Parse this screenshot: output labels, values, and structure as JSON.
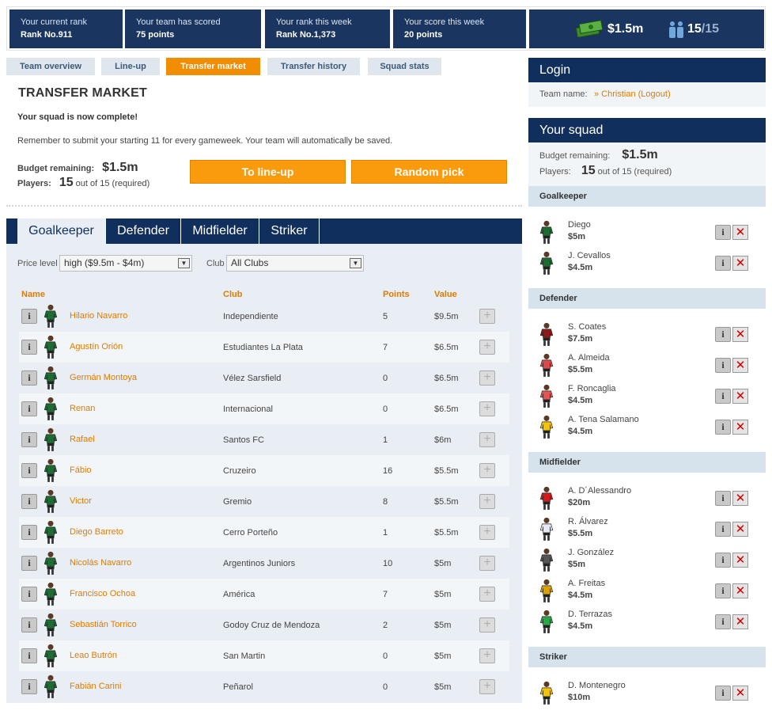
{
  "header": {
    "stats": [
      {
        "title": "Your current rank",
        "value": "Rank No.911"
      },
      {
        "title": "Your team has scored",
        "value": "75 points"
      },
      {
        "title": "Your rank this week",
        "value": "Rank No.1,373"
      },
      {
        "title": "Your score this week",
        "value": "20 points"
      }
    ],
    "budget": "$1.5m",
    "players_count": "15",
    "players_total": "/15"
  },
  "tabs": [
    "Team overview",
    "Line-up",
    "Transfer market",
    "Transfer history",
    "Squad stats"
  ],
  "transfer": {
    "title": "TRANSFER MARKET",
    "msg_complete": "Your squad is now complete!",
    "msg_reminder": "Remember to submit your starting 11 for every gameweek. Your team will automatically be saved.",
    "budget_label": "Budget remaining:",
    "budget_value": "$1.5m",
    "players_label": "Players:",
    "players_value": "15",
    "players_note": "out of 15 (required)",
    "btn_lineup": "To line-up",
    "btn_random": "Random pick"
  },
  "positions": [
    "Goalkeeper",
    "Defender",
    "Midfielder",
    "Striker"
  ],
  "filters": {
    "price_label": "Price level",
    "price_value": "high ($9.5m - $4m)",
    "club_label": "Club",
    "club_value": "All Clubs"
  },
  "columns": {
    "name": "Name",
    "club": "Club",
    "points": "Points",
    "value": "Value"
  },
  "players": [
    {
      "name": "Hilario Navarro",
      "club": "Independiente",
      "points": "5",
      "value": "$9.5m"
    },
    {
      "name": "Agustín Orión",
      "club": "Estudiantes La Plata",
      "points": "7",
      "value": "$6.5m"
    },
    {
      "name": "Germán Montoya",
      "club": "Vélez Sarsfield",
      "points": "0",
      "value": "$6.5m"
    },
    {
      "name": "Renan",
      "club": "Internacional",
      "points": "0",
      "value": "$6.5m"
    },
    {
      "name": "Rafael",
      "club": "Santos FC",
      "points": "1",
      "value": "$6m"
    },
    {
      "name": "Fábio",
      "club": "Cruzeiro",
      "points": "16",
      "value": "$5.5m"
    },
    {
      "name": "Victor",
      "club": "Gremio",
      "points": "8",
      "value": "$5.5m"
    },
    {
      "name": "Diego Barreto",
      "club": "Cerro Porteño",
      "points": "1",
      "value": "$5.5m"
    },
    {
      "name": "Nicolás Navarro",
      "club": "Argentinos Juniors",
      "points": "10",
      "value": "$5m"
    },
    {
      "name": "Francisco Ochoa",
      "club": "América",
      "points": "7",
      "value": "$5m"
    },
    {
      "name": "Sebastián Torrico",
      "club": "Godoy Cruz de Mendoza",
      "points": "2",
      "value": "$5m"
    },
    {
      "name": "Leao Butrón",
      "club": "San Martin",
      "points": "0",
      "value": "$5m"
    },
    {
      "name": "Fabián Carini",
      "club": "Peñarol",
      "points": "0",
      "value": "$5m"
    }
  ],
  "login": {
    "header": "Login",
    "team_label": "Team name:",
    "team_value": "» Christian (Logout)"
  },
  "squad": {
    "header": "Your squad",
    "budget_label": "Budget remaining:",
    "budget_value": "$1.5m",
    "players_label": "Players:",
    "players_value": "15",
    "players_note": "out of 15 (required)",
    "sections": [
      {
        "title": "Goalkeeper",
        "players": [
          {
            "name": "Diego",
            "price": "$5m",
            "kit": "#1f6b34"
          },
          {
            "name": "J. Cevallos",
            "price": "$4.5m",
            "kit": "#1f6b34"
          }
        ]
      },
      {
        "title": "Defender",
        "players": [
          {
            "name": "S. Coates",
            "price": "$7.5m",
            "kit": "#8b1a1a"
          },
          {
            "name": "A. Almeida",
            "price": "$5.5m",
            "kit": "#d94b4b"
          },
          {
            "name": "F. Roncaglia",
            "price": "$4.5m",
            "kit": "#e05555"
          },
          {
            "name": "A. Tena Salamano",
            "price": "$4.5m",
            "kit": "#f2c500"
          }
        ]
      },
      {
        "title": "Midfielder",
        "players": [
          {
            "name": "A. D´Alessandro",
            "price": "$20m",
            "kit": "#d01c1c"
          },
          {
            "name": "R. Álvarez",
            "price": "$5.5m",
            "kit": "#e8e8f4"
          },
          {
            "name": "J. González",
            "price": "$5m",
            "kit": "#555555"
          },
          {
            "name": "A. Freitas",
            "price": "$4.5m",
            "kit": "#d9a300"
          },
          {
            "name": "D. Terrazas",
            "price": "$4.5m",
            "kit": "#2aa847"
          }
        ]
      },
      {
        "title": "Striker",
        "players": [
          {
            "name": "D. Montenegro",
            "price": "$10m",
            "kit": "#f2c500"
          }
        ]
      }
    ]
  },
  "colors": {
    "navy": "#1a3560",
    "orange": "#f28c00",
    "gk_kit": "#1f6b34"
  }
}
